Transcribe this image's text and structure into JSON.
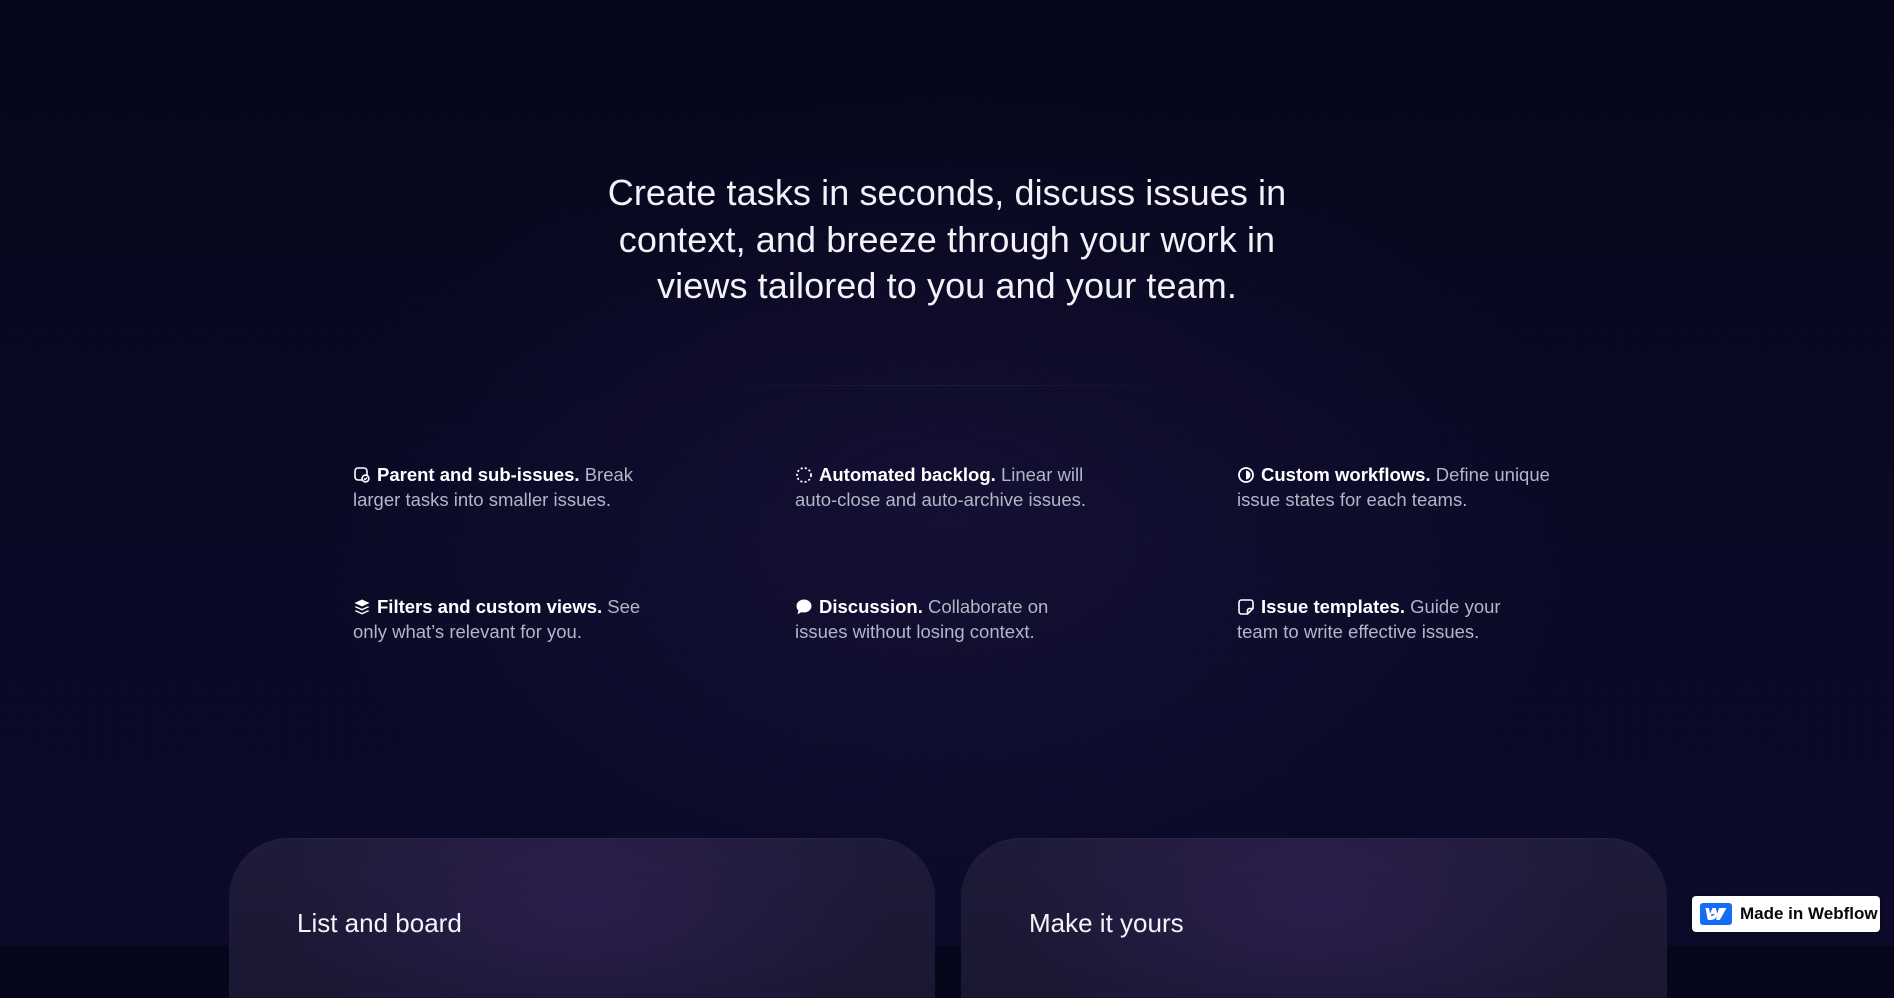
{
  "hero": {
    "lines": [
      "Create tasks in seconds, discuss issues in",
      "context, and breeze through your work in",
      "views tailored to you and your team."
    ]
  },
  "features": [
    {
      "icon": "sub-issue-icon",
      "title": "Parent and sub-issues.",
      "description": "Break larger tasks into smaller issues."
    },
    {
      "icon": "backlog-dashed-circle-icon",
      "title": "Automated backlog.",
      "description": "Linear will auto-close and auto-archive issues."
    },
    {
      "icon": "workflow-half-circle-icon",
      "title": "Custom workflows.",
      "description": "Define unique issue states for each teams."
    },
    {
      "icon": "layers-icon",
      "title": "Filters and custom views.",
      "description": "See only what’s relevant for you."
    },
    {
      "icon": "chat-bubble-icon",
      "title": "Discussion.",
      "description": "Collaborate on issues without losing context."
    },
    {
      "icon": "template-note-icon",
      "title": "Issue templates.",
      "description": "Guide your team to write effective issues."
    }
  ],
  "cards": [
    {
      "title": "List and board"
    },
    {
      "title": "Make it yours"
    }
  ],
  "badge": {
    "label": "Made in Webflow",
    "logo_color": "#146ef5"
  },
  "colors": {
    "background": "#080821",
    "heading_text": "#f2f2f8",
    "feature_title": "#ffffff",
    "feature_description": "#b4b5c6",
    "card_background": "#1d1a36"
  }
}
